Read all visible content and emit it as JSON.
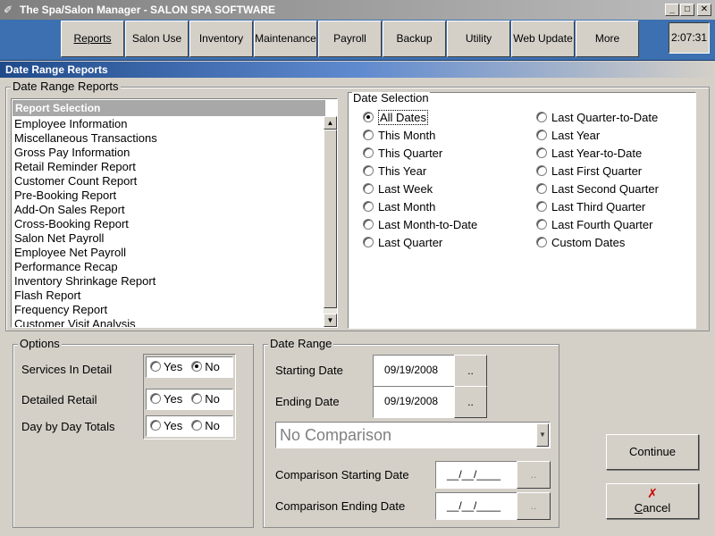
{
  "window": {
    "title": "The Spa/Salon Manager - SALON SPA SOFTWARE",
    "minimize": "_",
    "maximize": "□",
    "close": "✕"
  },
  "menu": {
    "items": [
      "Reports",
      "Salon Use",
      "Inventory",
      "Maintenance",
      "Payroll",
      "Backup",
      "Utility",
      "Web Update",
      "More"
    ],
    "clock": "2:07:31"
  },
  "section": {
    "title": "Date Range Reports"
  },
  "report_group": {
    "legend": "Date Range Reports",
    "list_header": "Report Selection",
    "items": [
      "Employee Information",
      "Miscellaneous Transactions",
      "Gross Pay Information",
      "Retail Reminder Report",
      "Customer Count Report",
      "Pre-Booking Report",
      "Add-On Sales Report",
      "Cross-Booking Report",
      "Salon Net Payroll",
      "Employee Net Payroll",
      "Performance Recap",
      "Inventory Shrinkage Report",
      "Flash Report",
      "Frequency Report",
      "Customer Visit Analysis"
    ]
  },
  "date_selection": {
    "legend": "Date Selection",
    "left_options": [
      "All Dates",
      "This Month",
      "This Quarter",
      "This Year",
      "Last Week",
      "Last Month",
      "Last Month-to-Date",
      "Last Quarter"
    ],
    "right_options": [
      "Last Quarter-to-Date",
      "Last Year",
      "Last Year-to-Date",
      "Last First Quarter",
      "Last Second Quarter",
      "Last Third Quarter",
      "Last Fourth Quarter",
      "Custom Dates"
    ],
    "selected": "All Dates"
  },
  "options": {
    "legend": "Options",
    "yes_label": "Yes",
    "no_label": "No",
    "rows": [
      {
        "label": "Services In Detail",
        "value": "No"
      },
      {
        "label": "Detailed Retail",
        "value": ""
      },
      {
        "label": "Day by Day Totals",
        "value": ""
      }
    ]
  },
  "date_range": {
    "legend": "Date Range",
    "starting_label": "Starting Date",
    "starting_value": "09/19/2008",
    "ending_label": "Ending Date",
    "ending_value": "09/19/2008",
    "picker_label": "..",
    "comparison_select": "No Comparison",
    "comparison_start_label": "Comparison Starting Date",
    "comparison_start_value": "__/__/____",
    "comparison_end_label": "Comparison Ending Date",
    "comparison_end_value": "__/__/____"
  },
  "actions": {
    "continue": "Continue",
    "cancel": "Cancel",
    "cancel_hotkey": "C",
    "cancel_rest": "ancel"
  },
  "colors": {
    "menubar": "#3c70b0",
    "header_start": "#1f4a8a",
    "cancel_icon": "#cc0000"
  }
}
